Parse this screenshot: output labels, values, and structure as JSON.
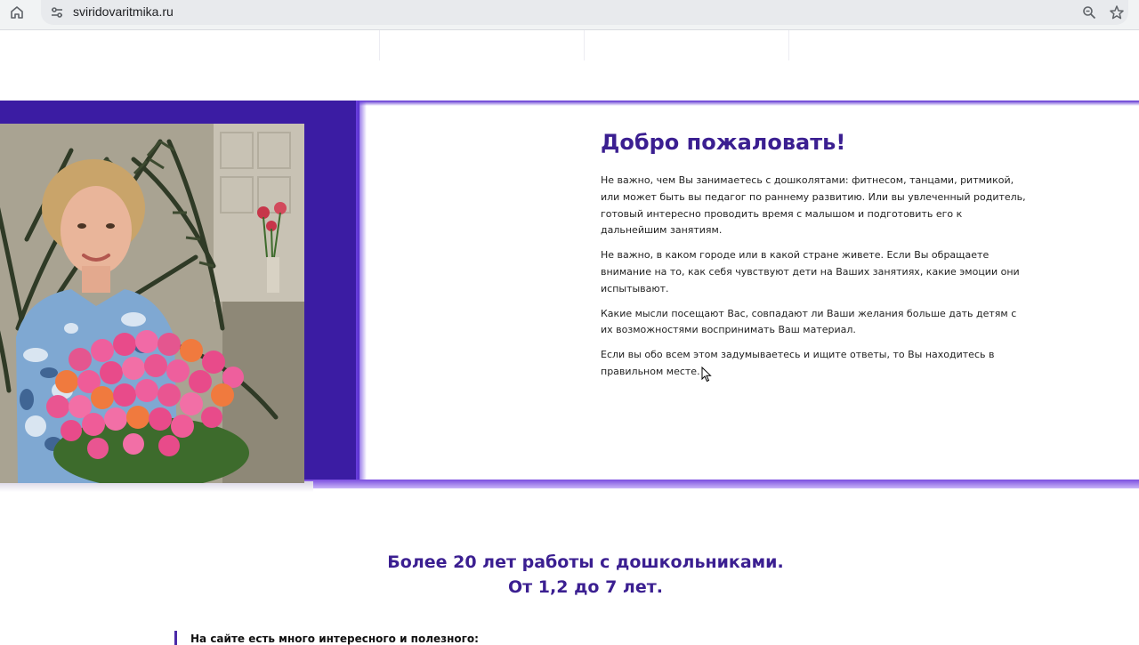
{
  "browser": {
    "url": "sviridovaritmika.ru"
  },
  "welcome": {
    "title": "Добро пожаловать!",
    "paragraphs": [
      "Не важно, чем Вы занимаетесь с дошколятами: фитнесом, танцами, ритмикой, или может быть вы педагог по раннему развитию. Или вы увлеченный родитель, готовый интересно проводить время с малышом и подготовить его к дальнейшим занятиям.",
      "Не важно, в каком городе или в какой стране живете. Если Вы обращаете внимание на то, как себя чувствуют дети на Ваших занятиях, какие эмоции они испытывают.",
      "Какие мысли посещают Вас, совпадают ли Ваши желания больше дать детям с их возможностями воспринимать Ваш материал.",
      "Если вы обо всем этом задумываетесь и ищите ответы, то Вы находитесь в правильном месте."
    ]
  },
  "experience": {
    "line1": "Более 20 лет работы с дошкольниками.",
    "line2": "От 1,2 до 7 лет."
  },
  "note": {
    "text": "На сайте есть много интересного и полезного:"
  },
  "colors": {
    "accent": "#3b1f91",
    "panel": "#3b1ca3"
  }
}
